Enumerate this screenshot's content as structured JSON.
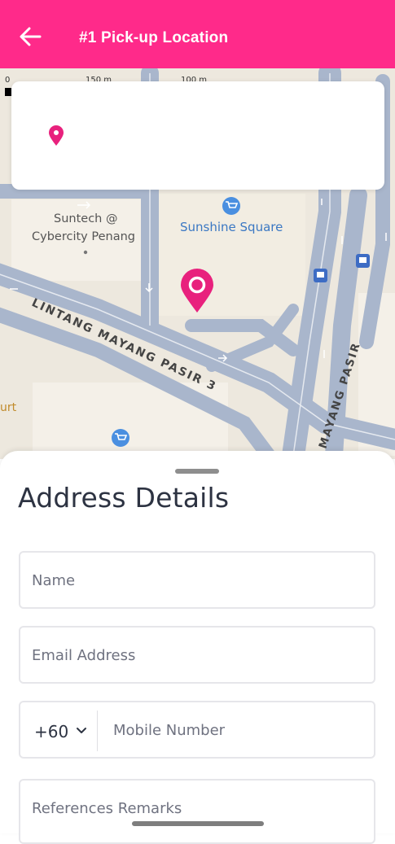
{
  "header": {
    "title": "#1 Pick-up Location",
    "back_icon": "arrow-left-icon",
    "background": "#ff2a8a"
  },
  "map": {
    "labels": {
      "suntech_line1": "Suntech @",
      "suntech_line2": "Cybercity Penang",
      "sunshine": "Sunshine Square",
      "lintang": "LINTANG MAYANG PASIR 3",
      "mayang": "MAYANG PASIR",
      "urt": "urt",
      "scale_left": "0",
      "scale_mid": "150 m",
      "scale_right": "100 m"
    },
    "pin_color": "#e8217d"
  },
  "address_details": {
    "title": "Address Details",
    "name_placeholder": "Name",
    "email_placeholder": "Email Address",
    "country_code": "+60",
    "mobile_placeholder": "Mobile Number",
    "remarks_placeholder": "References Remarks"
  }
}
